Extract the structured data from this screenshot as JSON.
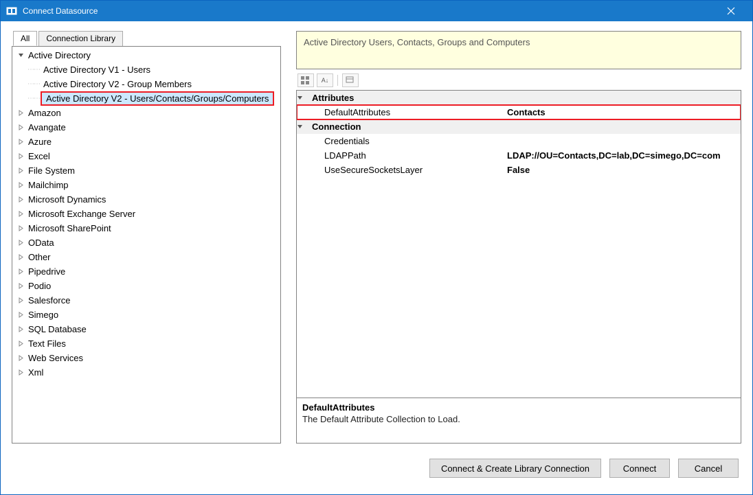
{
  "window": {
    "title": "Connect Datasource"
  },
  "tabs": {
    "all": "All",
    "library": "Connection Library"
  },
  "tree": {
    "root": "Active Directory",
    "root_children": [
      "Active Directory V1 - Users",
      "Active Directory V2 - Group Members",
      "Active Directory V2 - Users/Contacts/Groups/Computers"
    ],
    "items": [
      "Amazon",
      "Avangate",
      "Azure",
      "Excel",
      "File System",
      "Mailchimp",
      "Microsoft Dynamics",
      "Microsoft Exchange Server",
      "Microsoft SharePoint",
      "OData",
      "Other",
      "Pipedrive",
      "Podio",
      "Salesforce",
      "Simego",
      "SQL Database",
      "Text Files",
      "Web Services",
      "Xml"
    ]
  },
  "banner": {
    "text": "Active Directory Users, Contacts, Groups and Computers"
  },
  "properties": {
    "category_attributes": "Attributes",
    "default_attributes_name": "DefaultAttributes",
    "default_attributes_value": "Contacts",
    "category_connection": "Connection",
    "credentials_name": "Credentials",
    "credentials_value": "",
    "ldappath_name": "LDAPPath",
    "ldappath_value": "LDAP://OU=Contacts,DC=lab,DC=simego,DC=com",
    "usessl_name": "UseSecureSocketsLayer",
    "usessl_value": "False"
  },
  "description": {
    "title": "DefaultAttributes",
    "text": "The Default Attribute Collection to Load."
  },
  "buttons": {
    "connect_create": "Connect & Create Library Connection",
    "connect": "Connect",
    "cancel": "Cancel"
  }
}
